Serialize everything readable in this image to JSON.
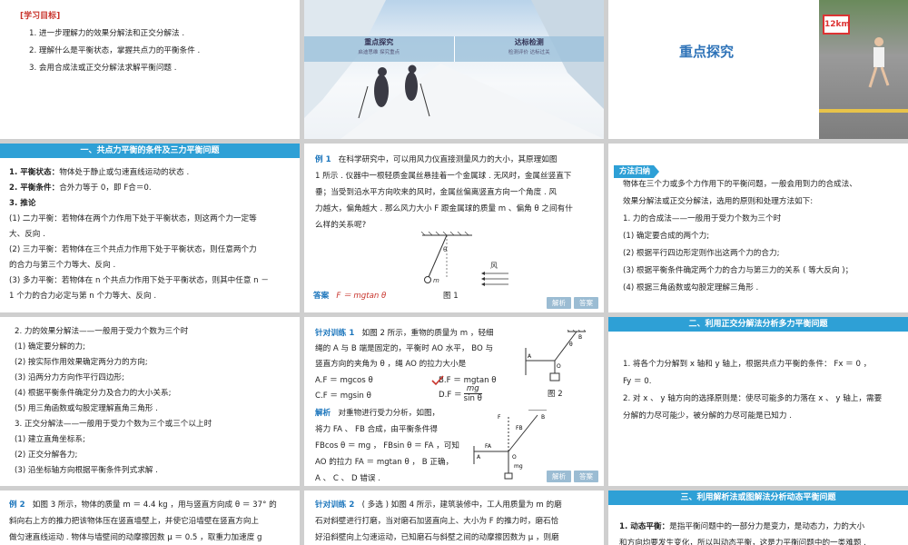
{
  "slides": {
    "s1": {
      "heading": "[学习目标]",
      "items": [
        "1. 进一步理解力的效果分解法和正交分解法 .",
        "2. 理解什么是平衡状态，掌握共点力的平衡条件 .",
        "3. 会用合成法或正交分解法求解平衡问题 ."
      ]
    },
    "s2": {
      "nav_left_title": "重点探究",
      "nav_left_sub": "启迪思维  探究重点",
      "nav_right_title": "达标检测",
      "nav_right_sub": "检测评价  达标过关"
    },
    "s3": {
      "title": "重点探究",
      "sign": "12km"
    },
    "s4": {
      "bar": "一、共点力平衡的条件及三力平衡问题",
      "lines": [
        {
          "label": "1. 平衡状态：",
          "text": "物体处于静止或匀速直线运动的状态 ."
        },
        {
          "label": "2. 平衡条件：",
          "text": "合外力等于 0，即 F合＝0."
        },
        {
          "label": "3. 推论",
          "text": ""
        }
      ],
      "paras": [
        "(1) 二力平衡：若物体在两个力作用下处于平衡状态，则这两个力一定等",
        "大、反向 .",
        "(2) 三力平衡：若物体在三个共点力作用下处于平衡状态，则任意两个力",
        "的合力与第三个力等大、反向 .",
        "(3) 多力平衡：若物体在 n 个共点力作用下处于平衡状态，则其中任意 n －",
        "1 个力的合力必定与第 n 个力等大、反向 ."
      ]
    },
    "s5": {
      "label": "例 1",
      "lines": [
        "在科学研究中，可以用风力仪直接测量风力的大小，其原理如图",
        "1 所示 . 仪器中一根轻质金属丝悬挂着一个金属球 . 无风时，金属丝竖直下",
        "垂；当受到沿水平方向吹来的风时，金属丝偏离竖直方向一个角度 . 风",
        "力越大，偏角越大 . 那么风力大小 F 跟金属球的质量 m 、偏角 θ 之间有什",
        "么样的关系呢?"
      ],
      "wind": "风",
      "theta": "θ",
      "mass": "m",
      "fig": "图 1",
      "answer_label": "答案",
      "answer": "F ＝ mgtan θ",
      "btn_a": "解析",
      "btn_b": "答案"
    },
    "s6": {
      "tag": "方法归纳",
      "lines": [
        "物体在三个力或多个力作用下的平衡问题，一般会用到力的合成法、",
        "效果分解法或正交分解法，选用的原则和处理方法如下:",
        "1. 力的合成法——一般用于受力个数为三个时",
        "(1) 确定要合成的两个力;",
        "(2) 根据平行四边形定则作出这两个力的合力;",
        "(3) 根据平衡条件确定两个力的合力与第三力的关系 ( 等大反向 )；",
        "(4) 根据三角函数或勾股定理解三角形 ."
      ]
    },
    "s7": {
      "lines": [
        "2. 力的效果分解法——一般用于受力个数为三个时",
        "(1) 确定要分解的力;",
        "(2) 按实际作用效果确定两分力的方向;",
        "(3) 沿两分力方向作平行四边形;",
        "(4) 根据平衡条件确定分力及合力的大小关系;",
        "(5) 用三角函数或勾股定理解直角三角形 .",
        "3. 正交分解法——一般用于受力个数为三个或三个以上时",
        "(1) 建立直角坐标系;",
        "(2) 正交分解各力;",
        "(3) 沿坐标轴方向根据平衡条件列式求解 ."
      ]
    },
    "s8": {
      "label": "针对训练 1",
      "lines": [
        "如图 2 所示，重物的质量为 m ，轻细",
        "绳的 A 与 B 端是固定的，平衡时 AO 水平， BO 与",
        "竖直方向的夹角为 θ ，绳 AO 的拉力大小是"
      ],
      "optA": "A.F ＝ mgcos θ",
      "optB": "B.F ＝ mgtan θ",
      "optC": "C.F ＝ mgsin θ",
      "optD": "D.F ＝",
      "optD_num": "mg",
      "optD_den": "sin θ",
      "fig": "图 2",
      "analysis_label": "解析",
      "analysis": [
        "对重物进行受力分析，如图，",
        "将力 FA 、 FB 合成，由平衡条件得",
        "FBcos θ ＝ mg ， FBsin θ ＝ FA ，可知",
        "AO 的拉力 FA ＝ mgtan θ ， B 正确，",
        "A 、 C 、 D 错误 ."
      ],
      "pts": {
        "A": "A",
        "B": "B",
        "O": "O",
        "theta": "θ",
        "FA": "FA",
        "FB": "FB",
        "mg": "mg",
        "F": "F"
      },
      "btn_a": "解析",
      "btn_b": "答案"
    },
    "s9": {
      "bar": "二、利用正交分解法分析多力平衡问题",
      "lines": [
        "1. 将各个力分解到 x 轴和 y 轴上，根据共点力平衡的条件： Fx ＝ 0 ，",
        "Fy ＝ 0.",
        "2. 对 x 、 y 轴方向的选择原则是：使尽可能多的力落在 x 、 y 轴上，需要",
        "分解的力尽可能少，被分解的力尽可能是已知力 ."
      ]
    },
    "s10": {
      "label": "例 2",
      "lines": [
        "如图 3 所示，物体的质量 m ＝ 4.4 kg ，用与竖直方向成 θ ＝ 37° 的",
        "斜向右上方的推力把该物体压在竖直墙壁上，并使它沿墙壁在竖直方向上",
        "做匀速直线运动 . 物体与墙壁间的动摩擦因数 μ ＝ 0.5 ，取重力加速度 g"
      ]
    },
    "s11": {
      "label": "针对训练 2",
      "lines": [
        "( 多选 ) 如图 4 所示，建筑装修中，工人用质量为 m 的磨",
        "石对斜壁进行打磨，当对磨石加竖直向上、大小为 F 的推力时，磨石恰",
        "好沿斜壁向上匀速运动，已知磨石与斜壁之间的动摩擦因数为 μ ，则磨"
      ]
    },
    "s12": {
      "bar": "三、利用解析法或图解法分析动态平衡问题",
      "label": "1. 动态平衡：",
      "lines": [
        "是指平衡问题中的一部分力是变力，是动态力，力的大小",
        "和方向均要发生变化，所以叫动态平衡，这是力平衡问题中的一类难题 ."
      ]
    }
  }
}
